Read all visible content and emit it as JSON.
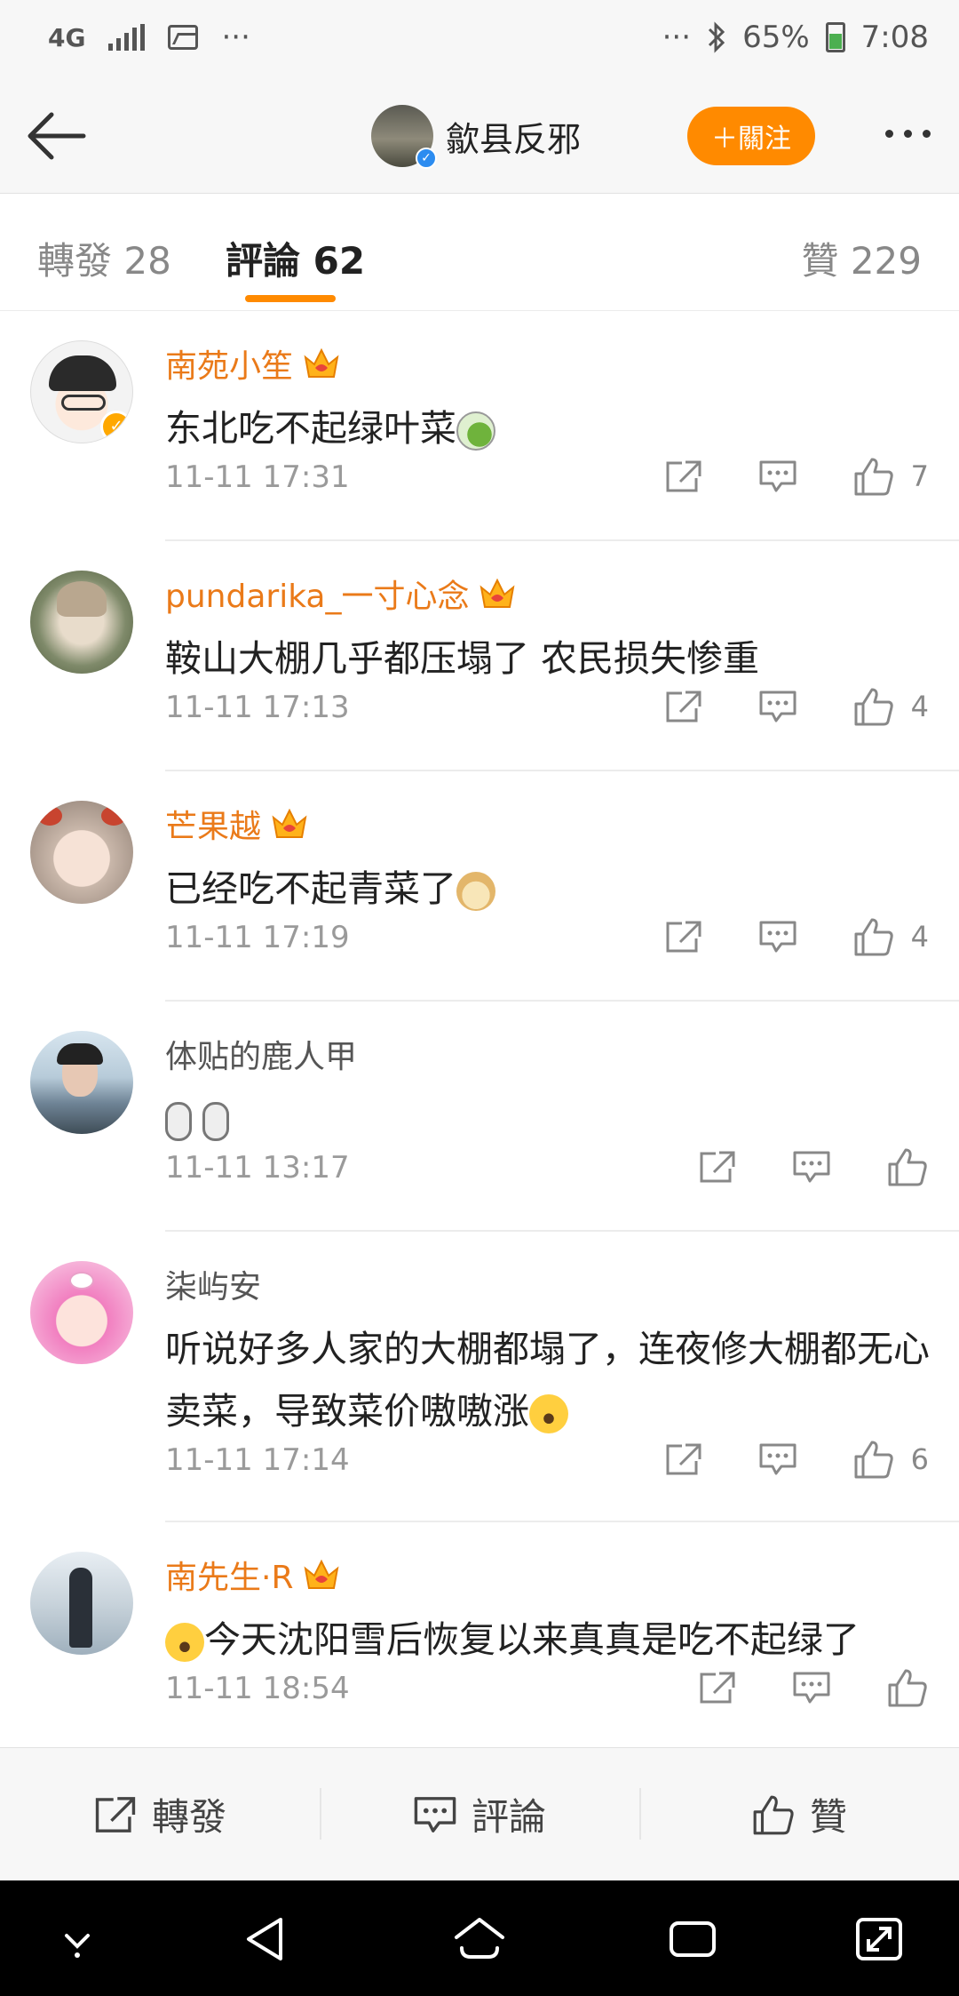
{
  "status_bar": {
    "network": "4G",
    "dots": "···",
    "dots_right": "···",
    "battery": "65%",
    "time": "7:08"
  },
  "header": {
    "title": "歙县反邪",
    "follow_label": "＋關注"
  },
  "tabs": {
    "repost": "轉發 28",
    "comment": "評論 62",
    "like": "贊 229"
  },
  "comments": [
    {
      "name": "南苑小笙",
      "text": "东北吃不起绿叶菜",
      "time": "11-11 17:31",
      "likes": "7"
    },
    {
      "name": "pundarika_一寸心念",
      "text": "鞍山大棚几乎都压塌了 农民损失惨重",
      "time": "11-11 17:13",
      "likes": "4"
    },
    {
      "name": "芒果越",
      "text": "已经吃不起青菜了",
      "time": "11-11 17:19",
      "likes": "4"
    },
    {
      "name": "体贴的鹿人甲",
      "text": "",
      "time": "11-11 13:17",
      "likes": ""
    },
    {
      "name": "柒屿安",
      "text": "听说好多人家的大棚都塌了，连夜修大棚都无心卖菜，导致菜价嗷嗷涨",
      "time": "11-11 17:14",
      "likes": "6"
    },
    {
      "name": "南先生·R",
      "text": "今天沈阳雪后恢复以来真真是吃不起绿了",
      "time": "11-11 18:54",
      "likes": ""
    }
  ],
  "bottom_bar": {
    "repost": "轉發",
    "comment": "評論",
    "like": "贊"
  },
  "colors": {
    "accent": "#ff8a00",
    "vip_name": "#ea7a19"
  }
}
